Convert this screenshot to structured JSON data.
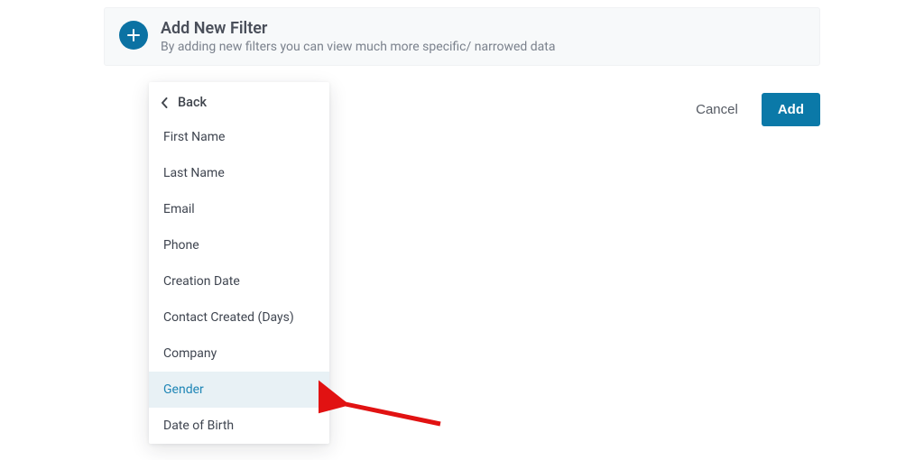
{
  "header": {
    "title": "Add New Filter",
    "subtitle": "By adding new filters you can view much more specific/ narrowed data"
  },
  "dropdown": {
    "back_label": "Back",
    "selected_index": 7,
    "options": [
      "First Name",
      "Last Name",
      "Email",
      "Phone",
      "Creation Date",
      "Contact Created (Days)",
      "Company",
      "Gender",
      "Date of Birth"
    ]
  },
  "buttons": {
    "cancel": "Cancel",
    "add": "Add"
  },
  "colors": {
    "accent": "#0b79a8",
    "selected_bg": "#e8f1f5",
    "selected_text": "#1f86b6",
    "arrow": "#e11212"
  }
}
